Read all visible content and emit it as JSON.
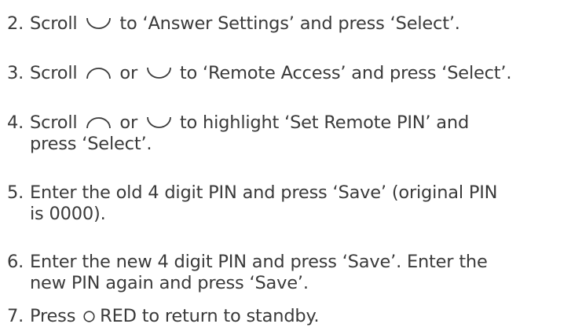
{
  "steps": [
    {
      "number": "2.",
      "segments": {
        "a": "Scroll",
        "icon1": "scroll-down-icon",
        "b": "to ‘Answer Settings’ and press ‘Select’."
      }
    },
    {
      "number": "3.",
      "segments": {
        "a": "Scroll",
        "icon1": "scroll-up-icon",
        "b": "or",
        "icon2": "scroll-down-icon",
        "c": "to ‘Remote Access’ and press ‘Select’."
      }
    },
    {
      "number": "4.",
      "segments": {
        "a": "Scroll",
        "icon1": "scroll-up-icon",
        "b": "or",
        "icon2": "scroll-down-icon",
        "c": "to highlight ‘Set Remote PIN’ and",
        "d": "press ‘Select’."
      }
    },
    {
      "number": "5.",
      "segments": {
        "a": "Enter the old 4 digit PIN and press ‘Save’ (original PIN",
        "b": "is 0000)."
      }
    },
    {
      "number": "6.",
      "segments": {
        "a": "Enter the new 4 digit PIN and press ‘Save’. Enter the",
        "b": "new PIN again and press ‘Save’."
      }
    },
    {
      "number": "7.",
      "segments": {
        "a": "Press",
        "icon1": "red-circle-icon",
        "b": "RED to return to standby."
      }
    }
  ]
}
